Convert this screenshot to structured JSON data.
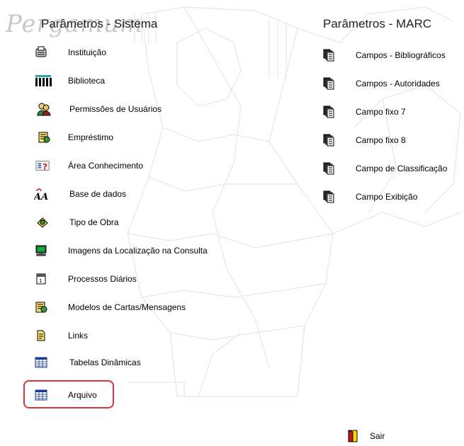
{
  "watermark": "Pergamum",
  "sistema": {
    "title": "Parâmetros - Sistema",
    "items": [
      {
        "label": "Instituição",
        "icon": "institution-icon"
      },
      {
        "label": "Biblioteca",
        "icon": "library-icon"
      },
      {
        "label": "Permissões de Usuários",
        "icon": "users-icon"
      },
      {
        "label": "Empréstimo",
        "icon": "loan-icon"
      },
      {
        "label": "Área Conhecimento",
        "icon": "knowledge-area-icon"
      },
      {
        "label": "Base de dados",
        "icon": "database-icon"
      },
      {
        "label": "Tipo de Obra",
        "icon": "work-type-icon"
      },
      {
        "label": "Imagens da Localização na Consulta",
        "icon": "monitor-icon"
      },
      {
        "label": "Processos Diários",
        "icon": "calendar-icon"
      },
      {
        "label": "Modelos de Cartas/Mensagens",
        "icon": "letters-icon"
      },
      {
        "label": "Links",
        "icon": "links-icon"
      },
      {
        "label": "Tabelas Dinâmicas",
        "icon": "table-icon"
      },
      {
        "label": "Arquivo",
        "icon": "table-icon"
      }
    ]
  },
  "marc": {
    "title": "Parâmetros - MARC",
    "items": [
      {
        "label": "Campos - Bibliográficos",
        "icon": "documents-icon"
      },
      {
        "label": "Campos - Autoridades",
        "icon": "documents-icon"
      },
      {
        "label": "Campo fixo 7",
        "icon": "documents-icon"
      },
      {
        "label": "Campo fixo 8",
        "icon": "documents-icon"
      },
      {
        "label": "Campo de Classificação",
        "icon": "documents-icon"
      },
      {
        "label": "Campo Exibição",
        "icon": "documents-icon"
      }
    ]
  },
  "exit": {
    "label": "Sair",
    "icon": "exit-door-icon"
  },
  "colors": {
    "highlight": "#e0303a",
    "watermark": "#c9c9c9"
  }
}
